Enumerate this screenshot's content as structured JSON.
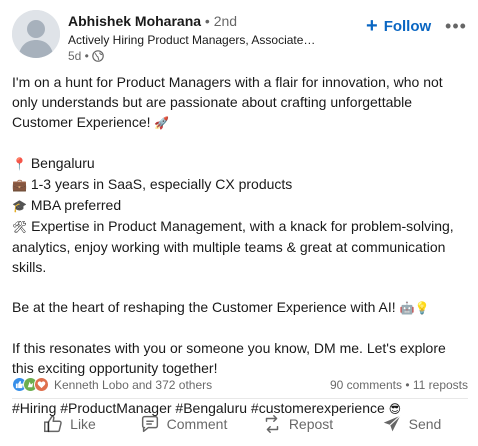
{
  "post": {
    "author": {
      "name": "Abhishek Moharana",
      "degree": "• 2nd",
      "headline": "Actively Hiring Product Managers, Associate…",
      "time": "5d •"
    },
    "follow_label": "Follow",
    "more_label": "•••",
    "body": {
      "intro": "I'm on a hunt for Product Managers with a flair for innovation, who not only understands but are passionate about crafting unforgettable Customer Experience! ",
      "intro_emoji": "🚀",
      "items": [
        {
          "emoji": "📍",
          "text": " Bengaluru"
        },
        {
          "emoji": "💼",
          "text": " 1-3 years in SaaS, especially CX products"
        },
        {
          "emoji": "🎓",
          "text": " MBA preferred"
        },
        {
          "emoji": "🛠",
          "text": " Expertise in Product Management, with a knack for problem-solving, analytics, enjoy working with multiple teams & great at communication skills."
        }
      ],
      "heart": "Be at the heart of reshaping the Customer Experience with AI! ",
      "heart_emoji": "🤖💡",
      "cta": "If this resonates with you or someone you know, DM me. Let's explore this exciting opportunity together!",
      "hashtags": "#Hiring #ProductManager #Bengaluru #customerexperience ",
      "hashtags_emoji": "😎"
    },
    "social": {
      "reactions_text": "Kenneth Lobo and 372 others",
      "counts": "90 comments • 11 reposts"
    },
    "actions": {
      "like": "Like",
      "comment": "Comment",
      "repost": "Repost",
      "send": "Send"
    },
    "colors": {
      "accent": "#0a66c2",
      "like": "#378fe9",
      "celebrate": "#6dae4f",
      "love": "#df704d"
    }
  }
}
